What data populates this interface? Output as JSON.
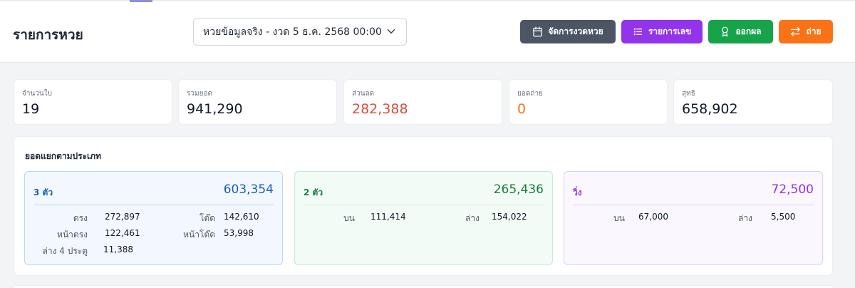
{
  "header": {
    "title": "รายการหวย",
    "round_select": "หวยข้อมูลจริง - งวด 5 ธ.ค. 2568 00:00",
    "buttons": {
      "manage": "จัดการงวดหวย",
      "numbers": "รายการเลข",
      "result": "ออกผล",
      "transfer": "ถ่าย"
    }
  },
  "stats": [
    {
      "label": "จำนวนใบ",
      "value": "19"
    },
    {
      "label": "รวมยอด",
      "value": "941,290"
    },
    {
      "label": "ส่วนลด",
      "value": "282,388"
    },
    {
      "label": "ยอดถ่าย",
      "value": "0"
    },
    {
      "label": "สุทธิ",
      "value": "658,902"
    }
  ],
  "breakdown": {
    "title": "ยอดแยกตามประเภท",
    "three": {
      "name": "3 ตัว",
      "total": "603,354",
      "rows": [
        {
          "label": "ตรง",
          "value": "272,897"
        },
        {
          "label": "โต๊ด",
          "value": "142,610"
        },
        {
          "label": "หน้าตรง",
          "value": "122,461"
        },
        {
          "label": "หน้าโต๊ด",
          "value": "53,998"
        },
        {
          "label": "ล่าง 4 ประตู",
          "value": "11,388"
        }
      ]
    },
    "two": {
      "name": "2 ตัว",
      "total": "265,436",
      "rows": [
        {
          "label": "บน",
          "value": "111,414"
        },
        {
          "label": "ล่าง",
          "value": "154,022"
        }
      ]
    },
    "run": {
      "name": "วิ่ง",
      "total": "72,500",
      "rows": [
        {
          "label": "บน",
          "value": "67,000"
        },
        {
          "label": "ล่าง",
          "value": "5,500"
        }
      ]
    }
  },
  "colors": {
    "manage_btn": "#4b5563",
    "numbers_btn": "#9333ea",
    "result_btn": "#16a34a",
    "transfer_btn": "#f97316",
    "discount": "#dc4c3e",
    "three_accent": "#1d5fb8",
    "two_accent": "#16803d",
    "run_accent": "#9333ea"
  },
  "icons": {
    "manage": "calendar-icon",
    "numbers": "list-icon",
    "result": "award-icon",
    "transfer": "swap-arrows-icon",
    "select": "chevron-down-icon"
  }
}
